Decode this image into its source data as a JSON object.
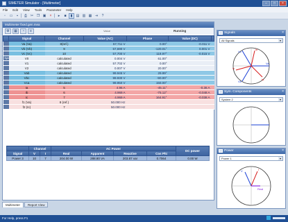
{
  "window": {
    "title": "SIMETER Simulator - [Multimeter]"
  },
  "menu": [
    "File",
    "Edit",
    "View",
    "Tools",
    "Parameter",
    "Help"
  ],
  "toolbar_icons": [
    "new-icon",
    "open-icon",
    "save-icon",
    "print-icon",
    "cut-icon",
    "copy-icon",
    "paste-icon",
    "delete-icon",
    "play-icon",
    "stop-icon",
    "chart-icon",
    "table-icon",
    "layout-icon",
    "window-icon",
    "export-icon",
    "help-icon"
  ],
  "doc": {
    "title": "Multimeter fixed.gen.mea",
    "value_label": "Value",
    "status": "Running",
    "columns": [
      "Signal",
      "Channel",
      "Value (AC)",
      "Phase",
      "Value (DC)"
    ],
    "group_label": "Symmetric",
    "rows": [
      {
        "style": "blue",
        "signal": "Va (Va)",
        "channel": "8(ref.)",
        "ac": "57,711 V",
        "phase": "0.00°",
        "dc": "-0.011 V"
      },
      {
        "style": "blue",
        "signal": "Vb (Vb)",
        "channel": "9",
        "ac": "57,690 V",
        "phase": "-120.01°",
        "dc": "0.001 V"
      },
      {
        "style": "blue",
        "signal": "Vc (Vc)",
        "channel": "10",
        "ac": "57,700 V",
        "phase": "119.97°",
        "dc": "-0.015 V"
      },
      {
        "style": "lbl",
        "signal": "V0",
        "channel": "calculated",
        "ac": "0.004 V",
        "phase": "61.00°",
        "dc": ""
      },
      {
        "style": "lbl",
        "signal": "V1",
        "channel": "calculated",
        "ac": "57.702 V",
        "phase": "0.00°",
        "dc": ""
      },
      {
        "style": "lbl",
        "signal": "V2",
        "channel": "calculated",
        "ac": "0.007 V",
        "phase": "20.00°",
        "dc": ""
      },
      {
        "style": "blue",
        "signal": "Vab",
        "channel": "calculated",
        "ac": "99.945 V",
        "phase": "29.99°",
        "dc": ""
      },
      {
        "style": "blue",
        "signal": "Vbc",
        "channel": "calculated",
        "ac": "99.930 V",
        "phase": "-90.00°",
        "dc": ""
      },
      {
        "style": "blue",
        "signal": "Vca",
        "channel": "calculated",
        "ac": "99.950 V",
        "phase": "150.00°",
        "dc": ""
      },
      {
        "style": "red",
        "signal": "Ia",
        "channel": "5",
        "ac": "4.96 A",
        "phase": "-45.11°",
        "dc": "-0.36 A"
      },
      {
        "style": "red",
        "signal": "Ib",
        "channel": "6",
        "ac": "4.969 A",
        "phase": "-75.12°",
        "dc": "-0.048 A"
      },
      {
        "style": "red",
        "signal": "Ic",
        "channel": "7",
        "ac": "4.969 A",
        "phase": "164.91°",
        "dc": "-0.038 A"
      },
      {
        "style": "pale",
        "signal": "f1 (Va)",
        "channel": "8 (ref.)",
        "ac": "50.000 Hz",
        "phase": "",
        "dc": ""
      },
      {
        "style": "pale",
        "signal": "f2 (Ic)",
        "channel": "7",
        "ac": "50.000 Hz",
        "phase": "",
        "dc": ""
      }
    ]
  },
  "power": {
    "group_headers": {
      "channel": "Channel",
      "ac_power": "AC Power",
      "dc_power": "DC power"
    },
    "columns": [
      "Signal",
      "V",
      "I",
      "Real",
      "Apparent",
      "Reactive",
      "Cos Phi"
    ],
    "row": {
      "signal": "Power 3",
      "v": "10",
      "i": "7",
      "real": "204.00 W",
      "apparent": "288.80 VA",
      "reactive": "203.87 var",
      "cosphi": "0.7064",
      "dc": "0.00 W"
    }
  },
  "panels": {
    "signals": {
      "title": "Signals",
      "select": "All Signals",
      "labels": [
        "Vc",
        "Va",
        "Vb",
        "Ic",
        "Ia",
        "Ib"
      ]
    },
    "symmetric": {
      "title": "Sym. Components",
      "select": "System 2"
    },
    "power": {
      "title": "Power",
      "select": "Power 1",
      "labels": [
        "V",
        "I",
        "Real"
      ]
    }
  },
  "tabs": [
    "Multimeter",
    "Report View"
  ],
  "status": {
    "text": "For Help, press F1"
  },
  "colors": {
    "voltage": "#1a3fd6",
    "current": "#d61a1a",
    "accent": "#1f4f94"
  }
}
